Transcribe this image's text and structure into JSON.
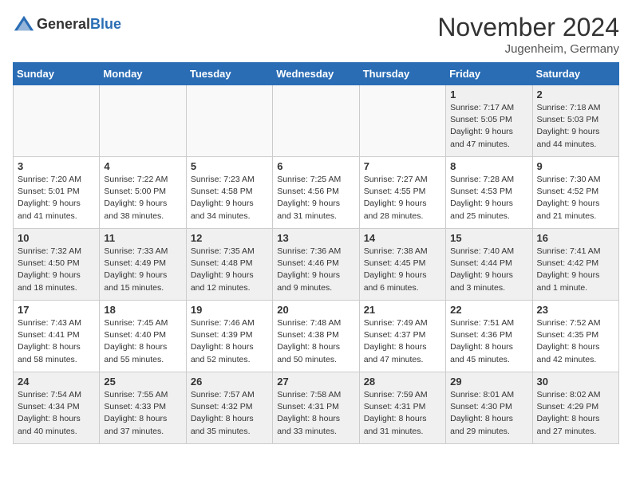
{
  "header": {
    "logo_general": "General",
    "logo_blue": "Blue",
    "month_title": "November 2024",
    "location": "Jugenheim, Germany"
  },
  "weekdays": [
    "Sunday",
    "Monday",
    "Tuesday",
    "Wednesday",
    "Thursday",
    "Friday",
    "Saturday"
  ],
  "weeks": [
    [
      {
        "day": "",
        "info": ""
      },
      {
        "day": "",
        "info": ""
      },
      {
        "day": "",
        "info": ""
      },
      {
        "day": "",
        "info": ""
      },
      {
        "day": "",
        "info": ""
      },
      {
        "day": "1",
        "info": "Sunrise: 7:17 AM\nSunset: 5:05 PM\nDaylight: 9 hours\nand 47 minutes."
      },
      {
        "day": "2",
        "info": "Sunrise: 7:18 AM\nSunset: 5:03 PM\nDaylight: 9 hours\nand 44 minutes."
      }
    ],
    [
      {
        "day": "3",
        "info": "Sunrise: 7:20 AM\nSunset: 5:01 PM\nDaylight: 9 hours\nand 41 minutes."
      },
      {
        "day": "4",
        "info": "Sunrise: 7:22 AM\nSunset: 5:00 PM\nDaylight: 9 hours\nand 38 minutes."
      },
      {
        "day": "5",
        "info": "Sunrise: 7:23 AM\nSunset: 4:58 PM\nDaylight: 9 hours\nand 34 minutes."
      },
      {
        "day": "6",
        "info": "Sunrise: 7:25 AM\nSunset: 4:56 PM\nDaylight: 9 hours\nand 31 minutes."
      },
      {
        "day": "7",
        "info": "Sunrise: 7:27 AM\nSunset: 4:55 PM\nDaylight: 9 hours\nand 28 minutes."
      },
      {
        "day": "8",
        "info": "Sunrise: 7:28 AM\nSunset: 4:53 PM\nDaylight: 9 hours\nand 25 minutes."
      },
      {
        "day": "9",
        "info": "Sunrise: 7:30 AM\nSunset: 4:52 PM\nDaylight: 9 hours\nand 21 minutes."
      }
    ],
    [
      {
        "day": "10",
        "info": "Sunrise: 7:32 AM\nSunset: 4:50 PM\nDaylight: 9 hours\nand 18 minutes."
      },
      {
        "day": "11",
        "info": "Sunrise: 7:33 AM\nSunset: 4:49 PM\nDaylight: 9 hours\nand 15 minutes."
      },
      {
        "day": "12",
        "info": "Sunrise: 7:35 AM\nSunset: 4:48 PM\nDaylight: 9 hours\nand 12 minutes."
      },
      {
        "day": "13",
        "info": "Sunrise: 7:36 AM\nSunset: 4:46 PM\nDaylight: 9 hours\nand 9 minutes."
      },
      {
        "day": "14",
        "info": "Sunrise: 7:38 AM\nSunset: 4:45 PM\nDaylight: 9 hours\nand 6 minutes."
      },
      {
        "day": "15",
        "info": "Sunrise: 7:40 AM\nSunset: 4:44 PM\nDaylight: 9 hours\nand 3 minutes."
      },
      {
        "day": "16",
        "info": "Sunrise: 7:41 AM\nSunset: 4:42 PM\nDaylight: 9 hours\nand 1 minute."
      }
    ],
    [
      {
        "day": "17",
        "info": "Sunrise: 7:43 AM\nSunset: 4:41 PM\nDaylight: 8 hours\nand 58 minutes."
      },
      {
        "day": "18",
        "info": "Sunrise: 7:45 AM\nSunset: 4:40 PM\nDaylight: 8 hours\nand 55 minutes."
      },
      {
        "day": "19",
        "info": "Sunrise: 7:46 AM\nSunset: 4:39 PM\nDaylight: 8 hours\nand 52 minutes."
      },
      {
        "day": "20",
        "info": "Sunrise: 7:48 AM\nSunset: 4:38 PM\nDaylight: 8 hours\nand 50 minutes."
      },
      {
        "day": "21",
        "info": "Sunrise: 7:49 AM\nSunset: 4:37 PM\nDaylight: 8 hours\nand 47 minutes."
      },
      {
        "day": "22",
        "info": "Sunrise: 7:51 AM\nSunset: 4:36 PM\nDaylight: 8 hours\nand 45 minutes."
      },
      {
        "day": "23",
        "info": "Sunrise: 7:52 AM\nSunset: 4:35 PM\nDaylight: 8 hours\nand 42 minutes."
      }
    ],
    [
      {
        "day": "24",
        "info": "Sunrise: 7:54 AM\nSunset: 4:34 PM\nDaylight: 8 hours\nand 40 minutes."
      },
      {
        "day": "25",
        "info": "Sunrise: 7:55 AM\nSunset: 4:33 PM\nDaylight: 8 hours\nand 37 minutes."
      },
      {
        "day": "26",
        "info": "Sunrise: 7:57 AM\nSunset: 4:32 PM\nDaylight: 8 hours\nand 35 minutes."
      },
      {
        "day": "27",
        "info": "Sunrise: 7:58 AM\nSunset: 4:31 PM\nDaylight: 8 hours\nand 33 minutes."
      },
      {
        "day": "28",
        "info": "Sunrise: 7:59 AM\nSunset: 4:31 PM\nDaylight: 8 hours\nand 31 minutes."
      },
      {
        "day": "29",
        "info": "Sunrise: 8:01 AM\nSunset: 4:30 PM\nDaylight: 8 hours\nand 29 minutes."
      },
      {
        "day": "30",
        "info": "Sunrise: 8:02 AM\nSunset: 4:29 PM\nDaylight: 8 hours\nand 27 minutes."
      }
    ]
  ]
}
